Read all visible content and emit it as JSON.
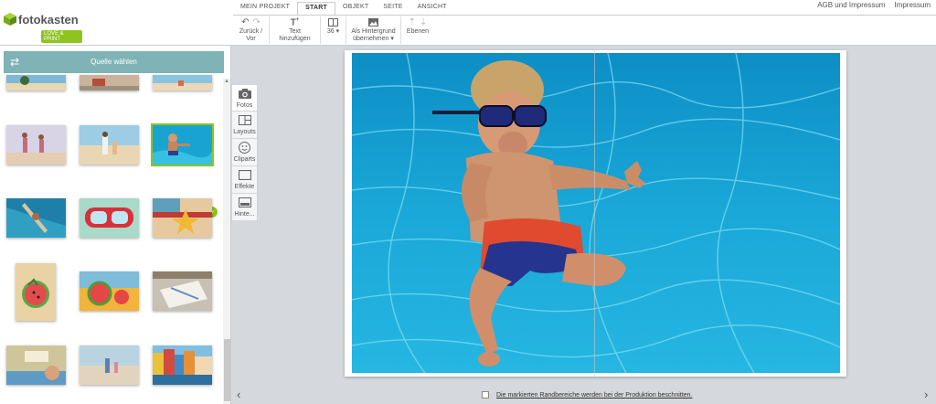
{
  "brand": {
    "name": "fotokasten",
    "tagline": "LOVE & PRINT",
    "accent": "#8fc31f"
  },
  "tabs": [
    {
      "label": "MEIN PROJEKT"
    },
    {
      "label": "START",
      "active": true
    },
    {
      "label": "OBJEKT"
    },
    {
      "label": "SEITE"
    },
    {
      "label": "ANSICHT"
    }
  ],
  "toolbar": {
    "undo_label": "Zurück / Vor",
    "text_label": "Text hinzufügen",
    "size_value": "36 ▾",
    "bg_label_1": "Als Hintergrund",
    "bg_label_2": "übernehmen ▾",
    "layers_label": "Ebenen"
  },
  "top_links": {
    "imprint_1": "AGB und Impressum",
    "imprint_2": "Impressum"
  },
  "sidebar": {
    "source_button": "Quelle wählen",
    "thumbnails": [
      {
        "scene": "beach-sand"
      },
      {
        "scene": "beach-rest"
      },
      {
        "scene": "beach-sea"
      },
      {
        "scene": "girls-jumping"
      },
      {
        "scene": "family-beach"
      },
      {
        "scene": "boy-pool",
        "selected": true
      },
      {
        "scene": "canoe"
      },
      {
        "scene": "diving-mask"
      },
      {
        "scene": "starfish"
      },
      {
        "scene": "watermelon-portrait"
      },
      {
        "scene": "watermelon"
      },
      {
        "scene": "notebook"
      },
      {
        "scene": "reading"
      },
      {
        "scene": "kids-beach"
      },
      {
        "scene": "colorful-houses"
      }
    ]
  },
  "side_tabs": [
    {
      "label": "Fotos",
      "icon": "camera-icon"
    },
    {
      "label": "Layouts",
      "icon": "layouts-icon"
    },
    {
      "label": "Cliparts",
      "icon": "smiley-icon"
    },
    {
      "label": "Effekte",
      "icon": "frame-icon"
    },
    {
      "label": "Hinte...",
      "icon": "background-icon"
    }
  ],
  "canvas": {
    "hint": "Die markierten Randbereiche werden bei der Produktion beschnitten."
  }
}
